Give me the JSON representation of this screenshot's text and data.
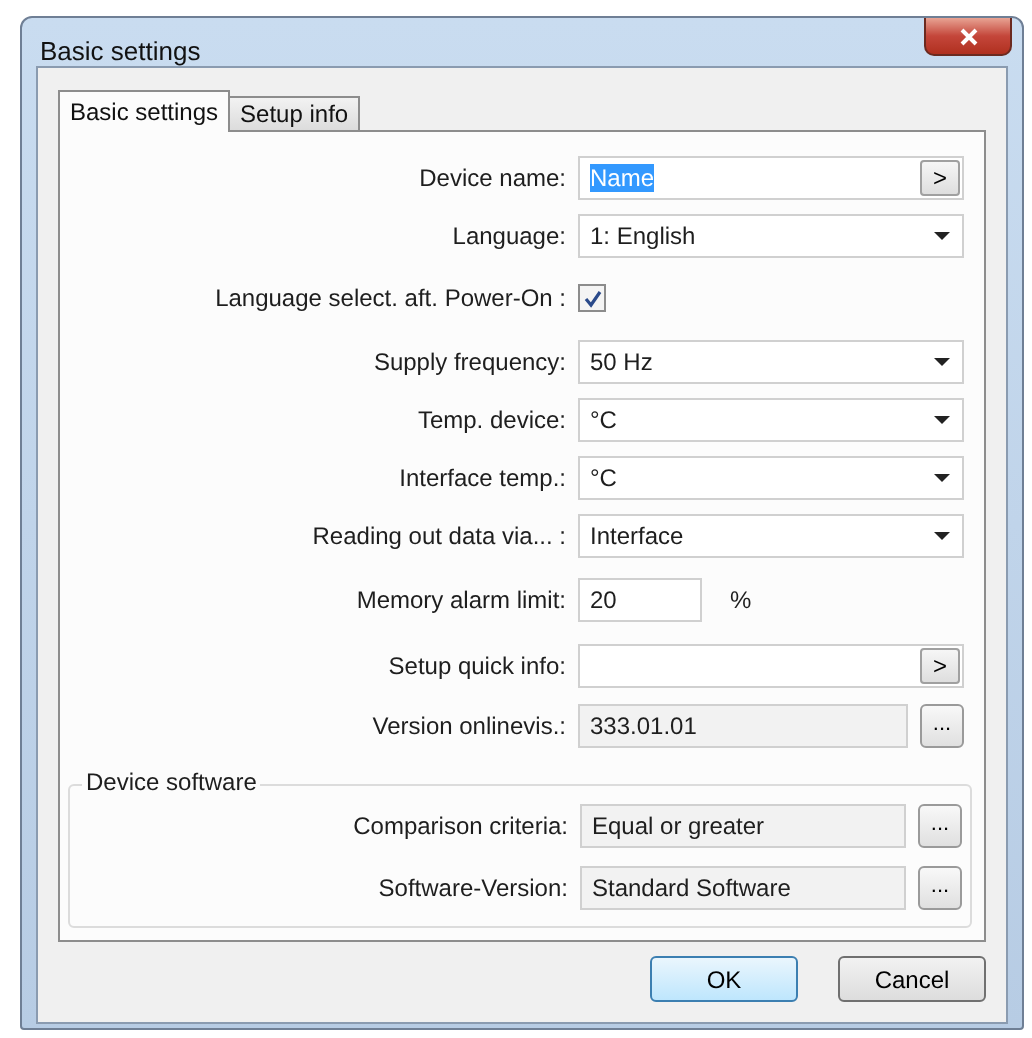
{
  "window": {
    "title": "Basic settings"
  },
  "tabs": [
    {
      "label": "Basic settings",
      "selected": true
    },
    {
      "label": "Setup info",
      "selected": false
    }
  ],
  "fields": [
    {
      "kind": "text-button",
      "label": "Device name:",
      "value": "Name",
      "value_selected": true,
      "button": ">"
    },
    {
      "kind": "select",
      "label": "Language:",
      "value": "1: English"
    },
    {
      "kind": "checkbox",
      "label": "Language select. aft. Power-On :",
      "checked": true
    },
    {
      "kind": "select",
      "label": "Supply frequency:",
      "value": "50 Hz"
    },
    {
      "kind": "select",
      "label": "Temp. device:",
      "value": "°C"
    },
    {
      "kind": "select",
      "label": "Interface temp.:",
      "value": "°C"
    },
    {
      "kind": "select",
      "label": "Reading out data via... :",
      "value": "Interface"
    },
    {
      "kind": "short",
      "label": "Memory alarm limit:",
      "value": "20",
      "unit": "%"
    },
    {
      "kind": "text-button",
      "label": "Setup quick info:",
      "button": ">"
    },
    {
      "kind": "readonly",
      "label": "Version onlinevis.:",
      "value": "333.01.01",
      "button": "..."
    }
  ],
  "device_software": {
    "title": "Device software",
    "fields": [
      {
        "kind": "readonly",
        "label": "Comparison criteria:",
        "value": "Equal or greater",
        "button": "..."
      },
      {
        "kind": "readonly",
        "label": "Software-Version:",
        "value": "Standard Software",
        "button": "..."
      }
    ]
  },
  "buttons": [
    {
      "label": "OK",
      "default": true
    },
    {
      "label": "Cancel",
      "default": false
    }
  ]
}
